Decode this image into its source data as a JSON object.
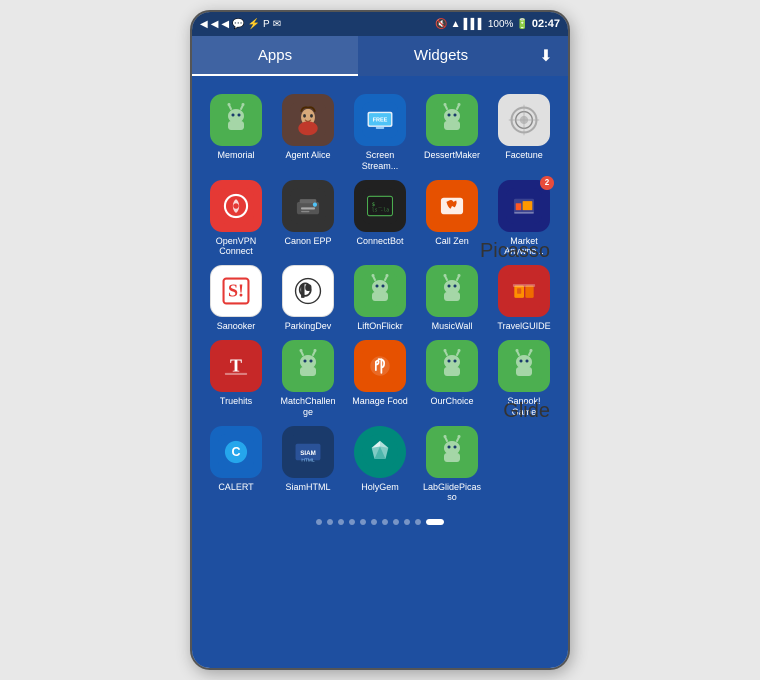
{
  "status_bar": {
    "time": "02:47",
    "battery": "100%",
    "icons_left": [
      "nav1",
      "nav2",
      "nav3",
      "messenger",
      "usb",
      "pinterest",
      "mail"
    ],
    "icons_right": [
      "mute",
      "wifi",
      "signal",
      "battery"
    ]
  },
  "tabs": [
    {
      "label": "Apps",
      "active": true
    },
    {
      "label": "Widgets",
      "active": false
    }
  ],
  "download_icon": "⬇",
  "apps": [
    {
      "name": "Memorial",
      "icon_type": "android",
      "color": "#4caf50"
    },
    {
      "name": "Agent Alice",
      "icon_type": "person",
      "color": "#5d4037"
    },
    {
      "name": "Screen Stream...",
      "icon_type": "screen",
      "color": "#1565c0"
    },
    {
      "name": "DessertMaker",
      "icon_type": "android",
      "color": "#4caf50"
    },
    {
      "name": "Facetune",
      "icon_type": "facetune",
      "color": "#b0bec5"
    },
    {
      "name": "OpenVPN Connect",
      "icon_type": "openvpn",
      "color": "#e53935"
    },
    {
      "name": "Canon EPP",
      "icon_type": "printer",
      "color": "#333"
    },
    {
      "name": "ConnectBot",
      "icon_type": "terminal",
      "color": "#212121"
    },
    {
      "name": "Call Zen",
      "icon_type": "callzen",
      "color": "#e65100"
    },
    {
      "name": "Market Anywhe...",
      "icon_type": "market",
      "color": "#1a237e",
      "badge": "2"
    },
    {
      "name": "Sanooker",
      "icon_type": "sanooker",
      "color": "#fff"
    },
    {
      "name": "ParkingDev",
      "icon_type": "parking",
      "color": "#fff"
    },
    {
      "name": "LiftOnFlickr",
      "icon_type": "android",
      "color": "#4caf50"
    },
    {
      "name": "MusicWall",
      "icon_type": "android",
      "color": "#4caf50"
    },
    {
      "name": "TravelGUIDE",
      "icon_type": "travel",
      "color": "#e53935"
    },
    {
      "name": "Truehits",
      "icon_type": "truehits",
      "color": "#c62828"
    },
    {
      "name": "MatchChallenge",
      "icon_type": "android",
      "color": "#4caf50"
    },
    {
      "name": "Manage Food",
      "icon_type": "managefood",
      "color": "#e65100"
    },
    {
      "name": "OurChoice",
      "icon_type": "android",
      "color": "#4caf50"
    },
    {
      "name": "Sanook! Game",
      "icon_type": "android",
      "color": "#4caf50"
    },
    {
      "name": "CALERT",
      "icon_type": "calert",
      "color": "#1565c0"
    },
    {
      "name": "SiamHTML",
      "icon_type": "siamhtml",
      "color": "#1a3a6b"
    },
    {
      "name": "HolyGem",
      "icon_type": "holygem",
      "color": "#00897b"
    },
    {
      "name": "LabGlidePicasso",
      "icon_type": "android",
      "color": "#4caf50"
    }
  ],
  "page_dots": [
    0,
    1,
    2,
    3,
    4,
    5,
    6,
    7,
    8,
    9,
    10
  ],
  "active_dot": 10,
  "side_labels": {
    "picasso": "Picasso",
    "glide": "Glide"
  }
}
